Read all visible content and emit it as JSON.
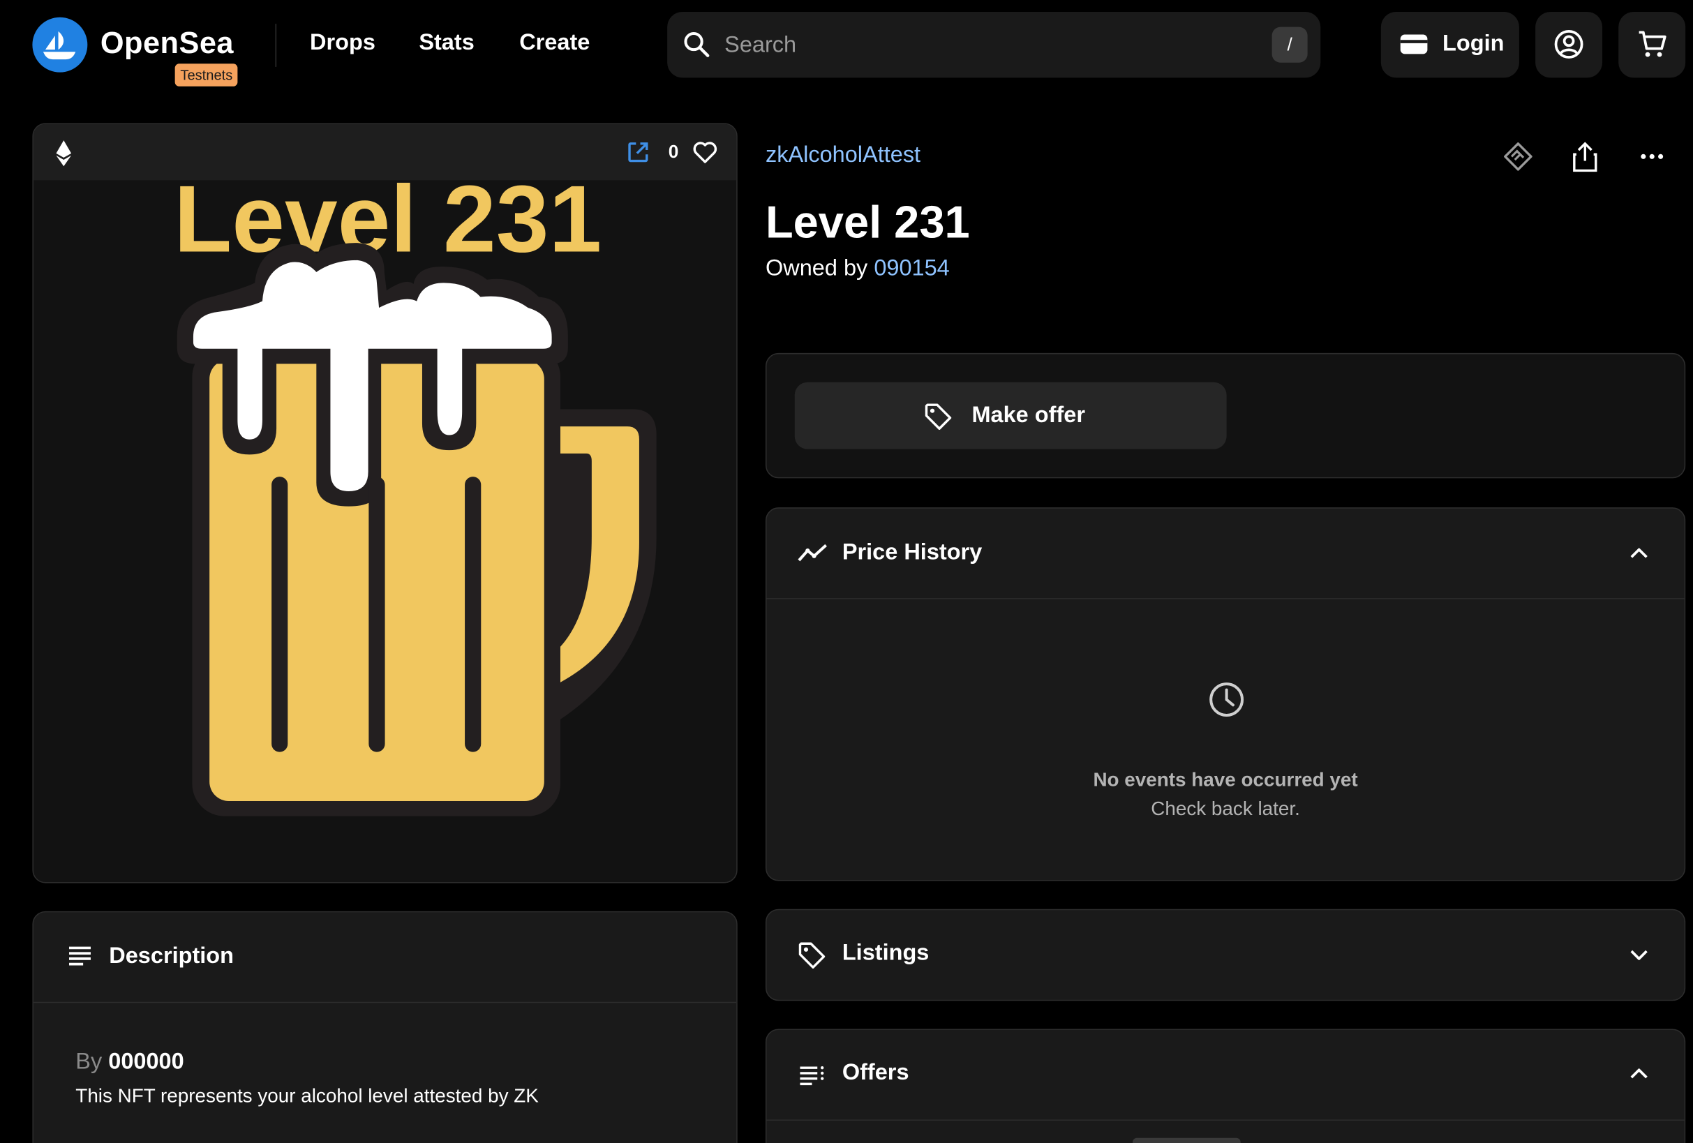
{
  "brand": {
    "name": "OpenSea",
    "badge": "Testnets",
    "accent": "#2081e2",
    "badge_color": "#f5a25d"
  },
  "nav": {
    "links": [
      "Drops",
      "Stats",
      "Create"
    ],
    "search_placeholder": "Search",
    "search_shortcut": "/",
    "login_label": "Login",
    "icons": [
      "search-icon",
      "wallet-icon",
      "account-icon",
      "cart-icon"
    ]
  },
  "media": {
    "chain_icon": "ethereum-icon",
    "favorite_count": "0",
    "art_text": "Level 231",
    "art_colors": {
      "beer": "#f1c75f",
      "foam": "#ffffff",
      "outline": "#231f20"
    }
  },
  "item": {
    "collection": "zkAlcoholAttest",
    "title": "Level 231",
    "owned_by_label": "Owned by",
    "owner": "090154",
    "link_color": "#8fc3ff"
  },
  "actions": {
    "make_offer": "Make offer"
  },
  "price_history": {
    "title": "Price History",
    "empty_title": "No events have occurred yet",
    "empty_sub": "Check back later."
  },
  "listings": {
    "title": "Listings"
  },
  "offers": {
    "title": "Offers"
  },
  "description": {
    "title": "Description",
    "by_label": "By",
    "creator": "000000",
    "text": "This NFT represents your alcohol level attested by ZK"
  }
}
